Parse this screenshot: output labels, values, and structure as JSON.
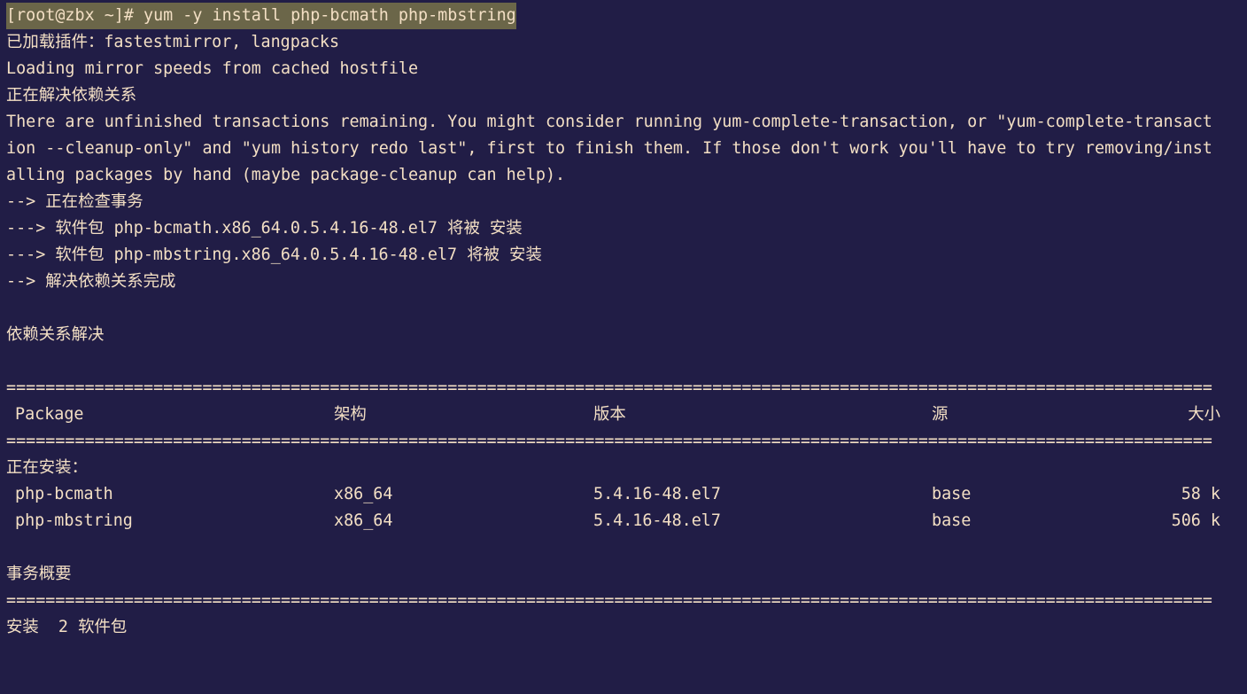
{
  "terminal": {
    "prompt": "[root@zbx ~]# yum -y install php-bcmath php-mbstring",
    "lines_top": [
      "已加载插件：fastestmirror, langpacks",
      "Loading mirror speeds from cached hostfile",
      "正在解决依赖关系",
      "There are unfinished transactions remaining. You might consider running yum-complete-transaction, or \"yum-complete-transact",
      "ion --cleanup-only\" and \"yum history redo last\", first to finish them. If those don't work you'll have to try removing/inst",
      "alling packages by hand (maybe package-cleanup can help).",
      "--> 正在检查事务",
      "---> 软件包 php-bcmath.x86_64.0.5.4.16-48.el7 将被 安装",
      "---> 软件包 php-mbstring.x86_64.0.5.4.16-48.el7 将被 安装",
      "--> 解决依赖关系完成",
      "",
      "依赖关系解决",
      ""
    ],
    "rule": "===========================================================================================================================",
    "table": {
      "headers": [
        "Package",
        "架构",
        "版本",
        "源",
        "大小"
      ],
      "section": "正在安装：",
      "rows": [
        [
          "php-bcmath",
          "x86_64",
          "5.4.16-48.el7",
          "base",
          "58 k"
        ],
        [
          "php-mbstring",
          "x86_64",
          "5.4.16-48.el7",
          "base",
          "506 k"
        ]
      ]
    },
    "summary_title": "事务概要",
    "summary_line": "安装  2 软件包"
  }
}
